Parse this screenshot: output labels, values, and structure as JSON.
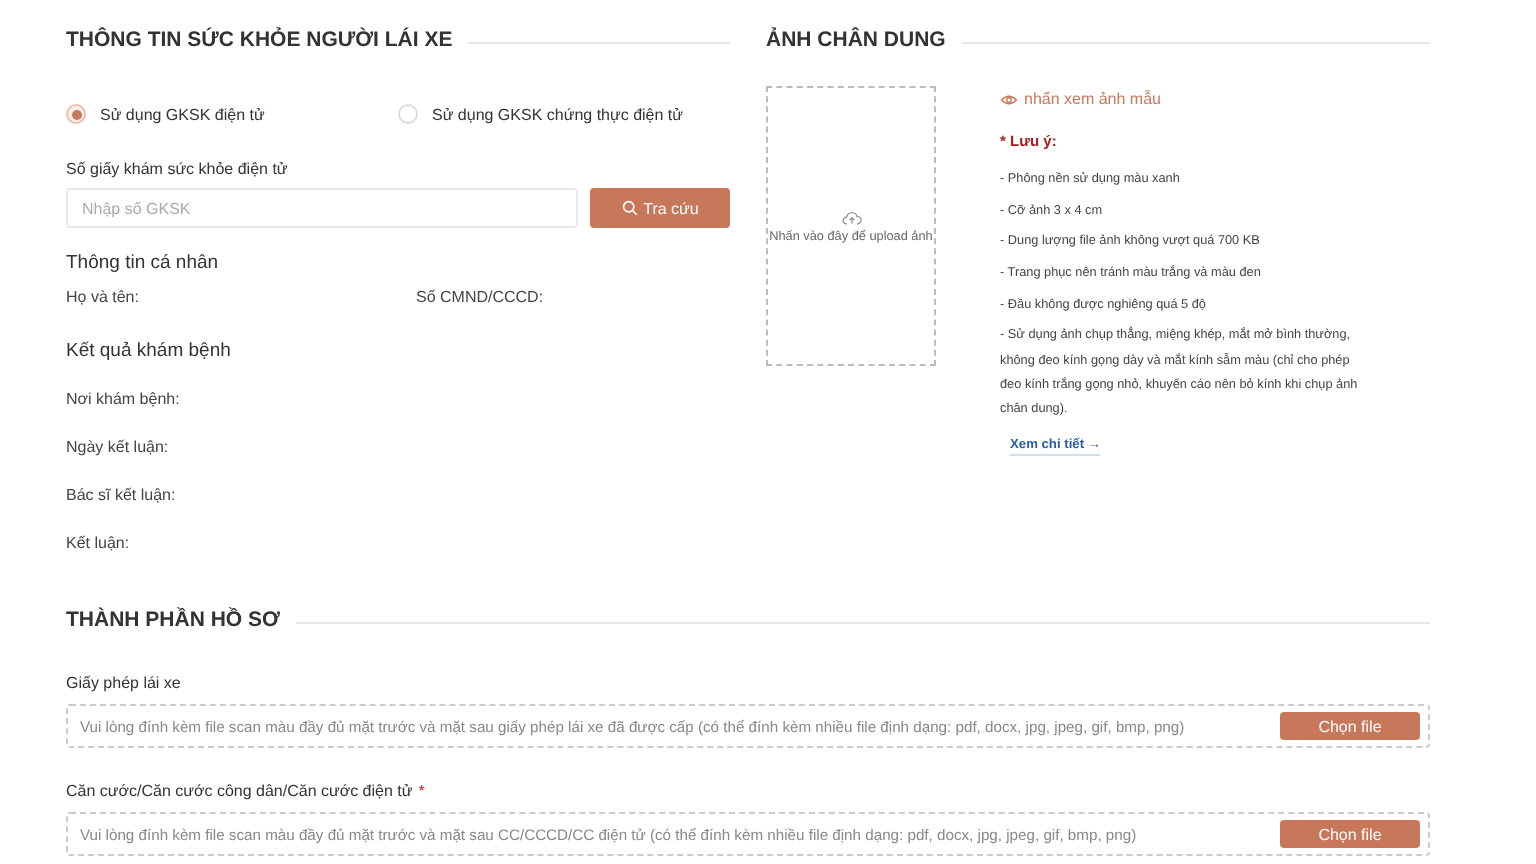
{
  "health": {
    "title": "THÔNG TIN SỨC KHỎE NGƯỜI LÁI XE",
    "options": [
      {
        "label": "Sử dụng GKSK điện tử",
        "selected": true
      },
      {
        "label": "Sử dụng GKSK chứng thực điện tử",
        "selected": false
      }
    ],
    "lookup": {
      "label": "Số giấy khám sức khỏe điện tử",
      "placeholder": "Nhập số GKSK",
      "button": "Tra cứu"
    },
    "personal": {
      "title": "Thông tin cá nhân",
      "fields": [
        "Họ và tên:",
        "Số CMND/CCCD:"
      ]
    },
    "results": {
      "title": "Kết quả khám bệnh",
      "fields": [
        "Nơi khám bệnh:",
        "Ngày kết luận:",
        "Bác sĩ kết luận:",
        "Kết luận:"
      ]
    }
  },
  "portrait": {
    "title": "ẢNH CHÂN DUNG",
    "upload_hint": "Nhấn vào đây để upload ảnh",
    "sample_link": "nhấn xem ảnh mẫu",
    "notes_title": "* Lưu ý:",
    "notes": [
      "- Phông nền sử dụng màu xanh",
      "- Cỡ ảnh 3 x 4 cm",
      "- Dung lượng file ảnh không vượt quá 700 KB",
      "- Trang phục nên tránh màu trắng và màu đen",
      "- Đầu không được nghiêng quá 5 độ",
      "- Sử dụng ảnh chụp thẳng, miệng khép, mắt mở bình thường, không đeo kính gọng dày và mắt kính sẫm màu (chỉ cho phép đeo kính trắng gọng nhỏ, khuyến cáo nên bỏ kính khi chụp ảnh chân dung)."
    ],
    "details_link": "Xem chi tiết →"
  },
  "documents": {
    "title": "THÀNH PHẦN HỒ SƠ",
    "items": [
      {
        "label": "Giấy phép lái xe",
        "hint": "Vui lòng đính kèm file scan màu đầy đủ mặt trước và mặt sau giấy phép lái xe đã được cấp (có thể đính kèm nhiều file định dạng: pdf, docx, jpg, jpeg, gif, bmp, png)",
        "button": "Chọn file"
      },
      {
        "label": "Căn cước/Căn cước công dân/Căn cước điện tử",
        "required_mark": "*",
        "hint": "Vui lòng đính kèm file scan màu đầy đủ mặt trước và mặt sau CC/CCCD/CC điện tử (có thể đính kèm nhiều file định dạng: pdf, docx, jpg, jpeg, gif, bmp, png)",
        "button": "Chọn file"
      }
    ]
  }
}
